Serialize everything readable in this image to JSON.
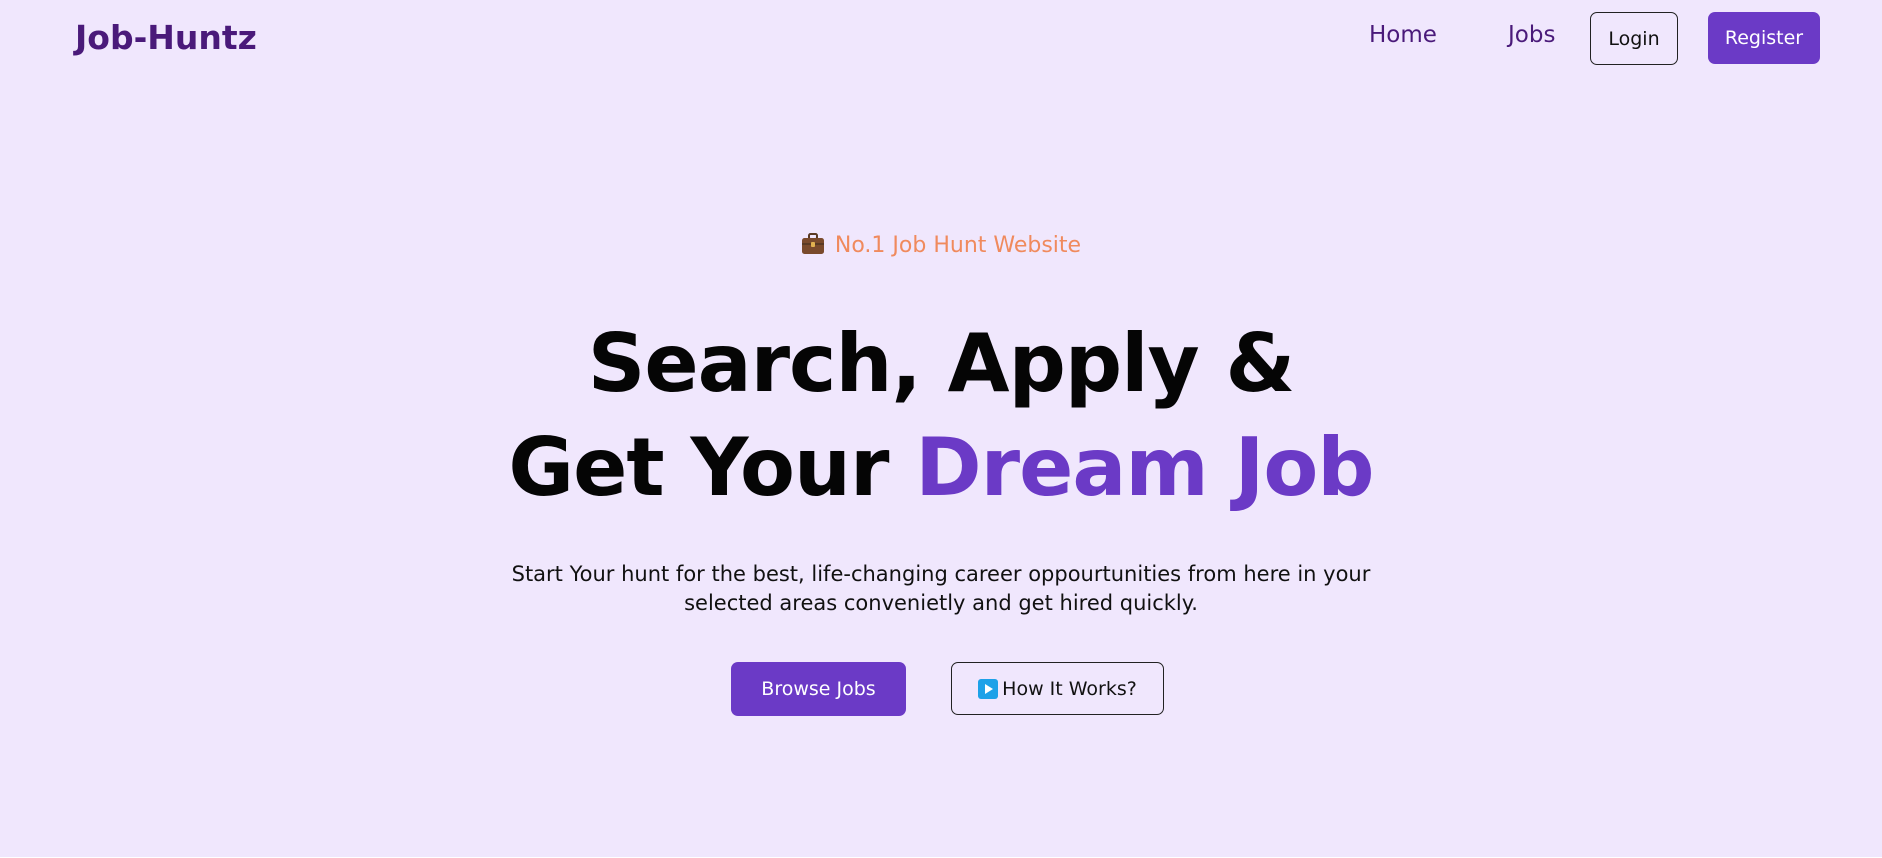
{
  "navbar": {
    "brand": "Job-Huntz",
    "links": [
      {
        "label": "Home"
      },
      {
        "label": "Jobs"
      }
    ],
    "login_label": "Login",
    "register_label": "Register"
  },
  "hero": {
    "tagline": "No.1 Job Hunt Website",
    "tagline_icon": "briefcase-icon",
    "headline_line1": "Search, Apply &",
    "headline_line2_prefix": "Get Your ",
    "headline_line2_accent": "Dream Job",
    "subtext_line1": "Start Your hunt for the best, life-changing career oppourtunities from here in your",
    "subtext_line2": "selected areas convenietly and get hired quickly.",
    "browse_label": "Browse Jobs",
    "how_label": "How It Works?",
    "how_icon": "play-icon"
  },
  "colors": {
    "background": "#f0e7fd",
    "brand": "#4a1a7a",
    "accent": "#6b3ac6",
    "tagline": "#f08a5d",
    "play_icon": "#1da1e8"
  }
}
